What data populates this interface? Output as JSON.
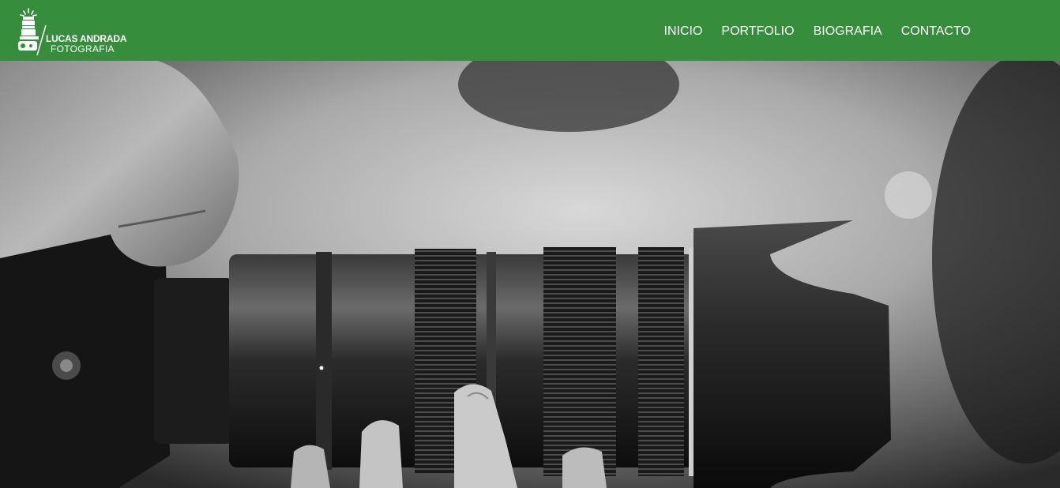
{
  "brand": {
    "line1": "LUCAS ANDRADA",
    "line2": "FOTOGRAFIA",
    "logo_icon": "camera-stack-icon"
  },
  "nav": {
    "items": [
      {
        "label": "INICIO"
      },
      {
        "label": "PORTFOLIO"
      },
      {
        "label": "BIOGRAFIA"
      },
      {
        "label": "CONTACTO"
      }
    ]
  },
  "colors": {
    "header_bg": "#368d3c",
    "nav_text": "#ffffff"
  },
  "hero": {
    "subject": "camera-lens-photo"
  }
}
